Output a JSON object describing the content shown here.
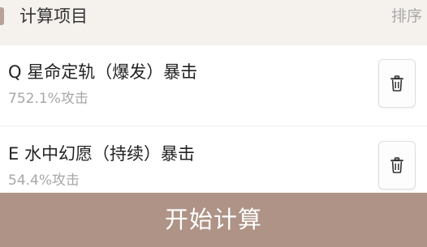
{
  "header": {
    "title": "计算项目",
    "sort_label": "排序"
  },
  "items": [
    {
      "name": "Q 星命定轨（爆发）暴击",
      "value": "752.1%攻击",
      "icon": "trash-icon"
    },
    {
      "name": "E 水中幻愿（持续）暴击",
      "value": "54.4%攻击",
      "icon": "trash-icon"
    }
  ],
  "footer": {
    "start_label": "开始计算"
  },
  "colors": {
    "header_bg": "#f5f1ed",
    "accent": "#b8a197",
    "primary_button": "#ae9386"
  }
}
